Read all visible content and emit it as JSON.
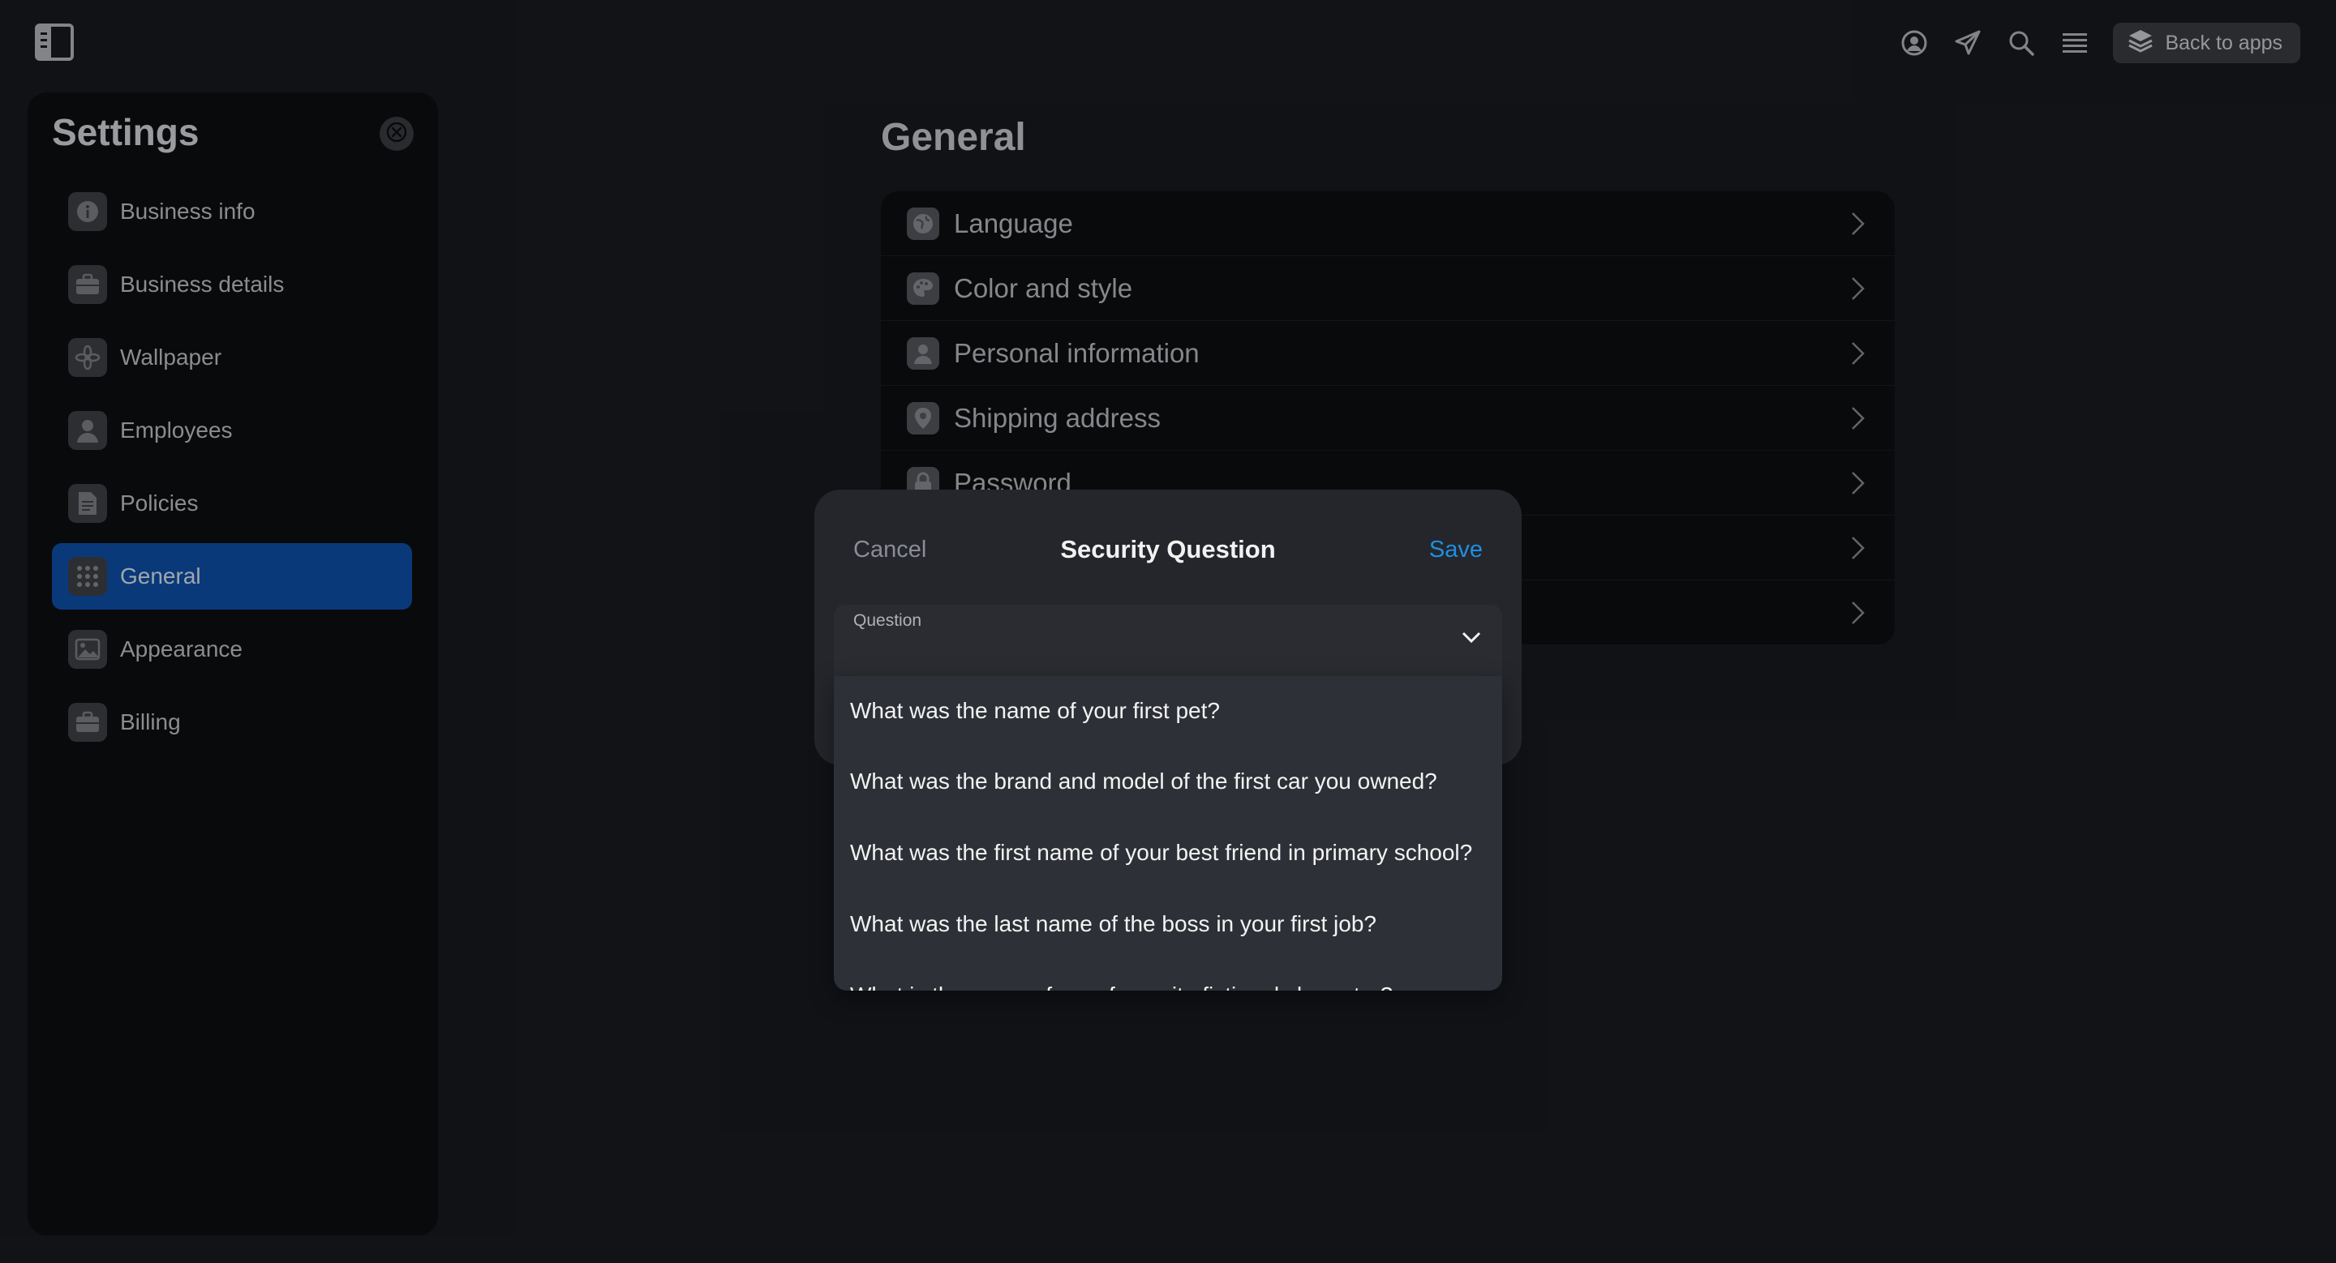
{
  "topbar": {
    "back_label": "Back to apps",
    "icons": [
      "sidebar-toggle-icon",
      "user-circle-icon",
      "send-icon",
      "search-icon",
      "menu-icon",
      "layers-icon"
    ]
  },
  "settings": {
    "title": "Settings",
    "items": [
      {
        "label": "Business info",
        "icon": "info-icon"
      },
      {
        "label": "Business details",
        "icon": "briefcase-icon"
      },
      {
        "label": "Wallpaper",
        "icon": "flower-icon"
      },
      {
        "label": "Employees",
        "icon": "person-icon"
      },
      {
        "label": "Policies",
        "icon": "document-icon"
      },
      {
        "label": "General",
        "icon": "grid-icon",
        "active": true
      },
      {
        "label": "Appearance",
        "icon": "image-icon"
      },
      {
        "label": "Billing",
        "icon": "briefcase-icon"
      }
    ]
  },
  "general": {
    "title": "General",
    "rows": [
      {
        "label": "Language",
        "icon": "globe-icon"
      },
      {
        "label": "Color and style",
        "icon": "palette-icon"
      },
      {
        "label": "Personal information",
        "icon": "person-icon"
      },
      {
        "label": "Shipping address",
        "icon": "location-pin-icon"
      },
      {
        "label": "Password",
        "icon": "lock-icon"
      },
      {
        "label": "",
        "icon": ""
      },
      {
        "label": "",
        "icon": ""
      }
    ]
  },
  "modal": {
    "cancel": "Cancel",
    "title": "Security Question",
    "save": "Save",
    "field_label": "Question",
    "options": [
      "What was the name of your first pet?",
      "What was the brand and model of the first car you owned?",
      "What was the first name of your best friend in primary school?",
      "What was the last name of the boss in your first job?",
      "What is the name of your favourite fictional character?"
    ]
  },
  "colors": {
    "background": "#181a1f",
    "panel": "#0d0e10",
    "active": "#0d4fa8",
    "accent": "#1e8fe0",
    "modal": "#24262b",
    "dropdown": "#2d3036"
  }
}
